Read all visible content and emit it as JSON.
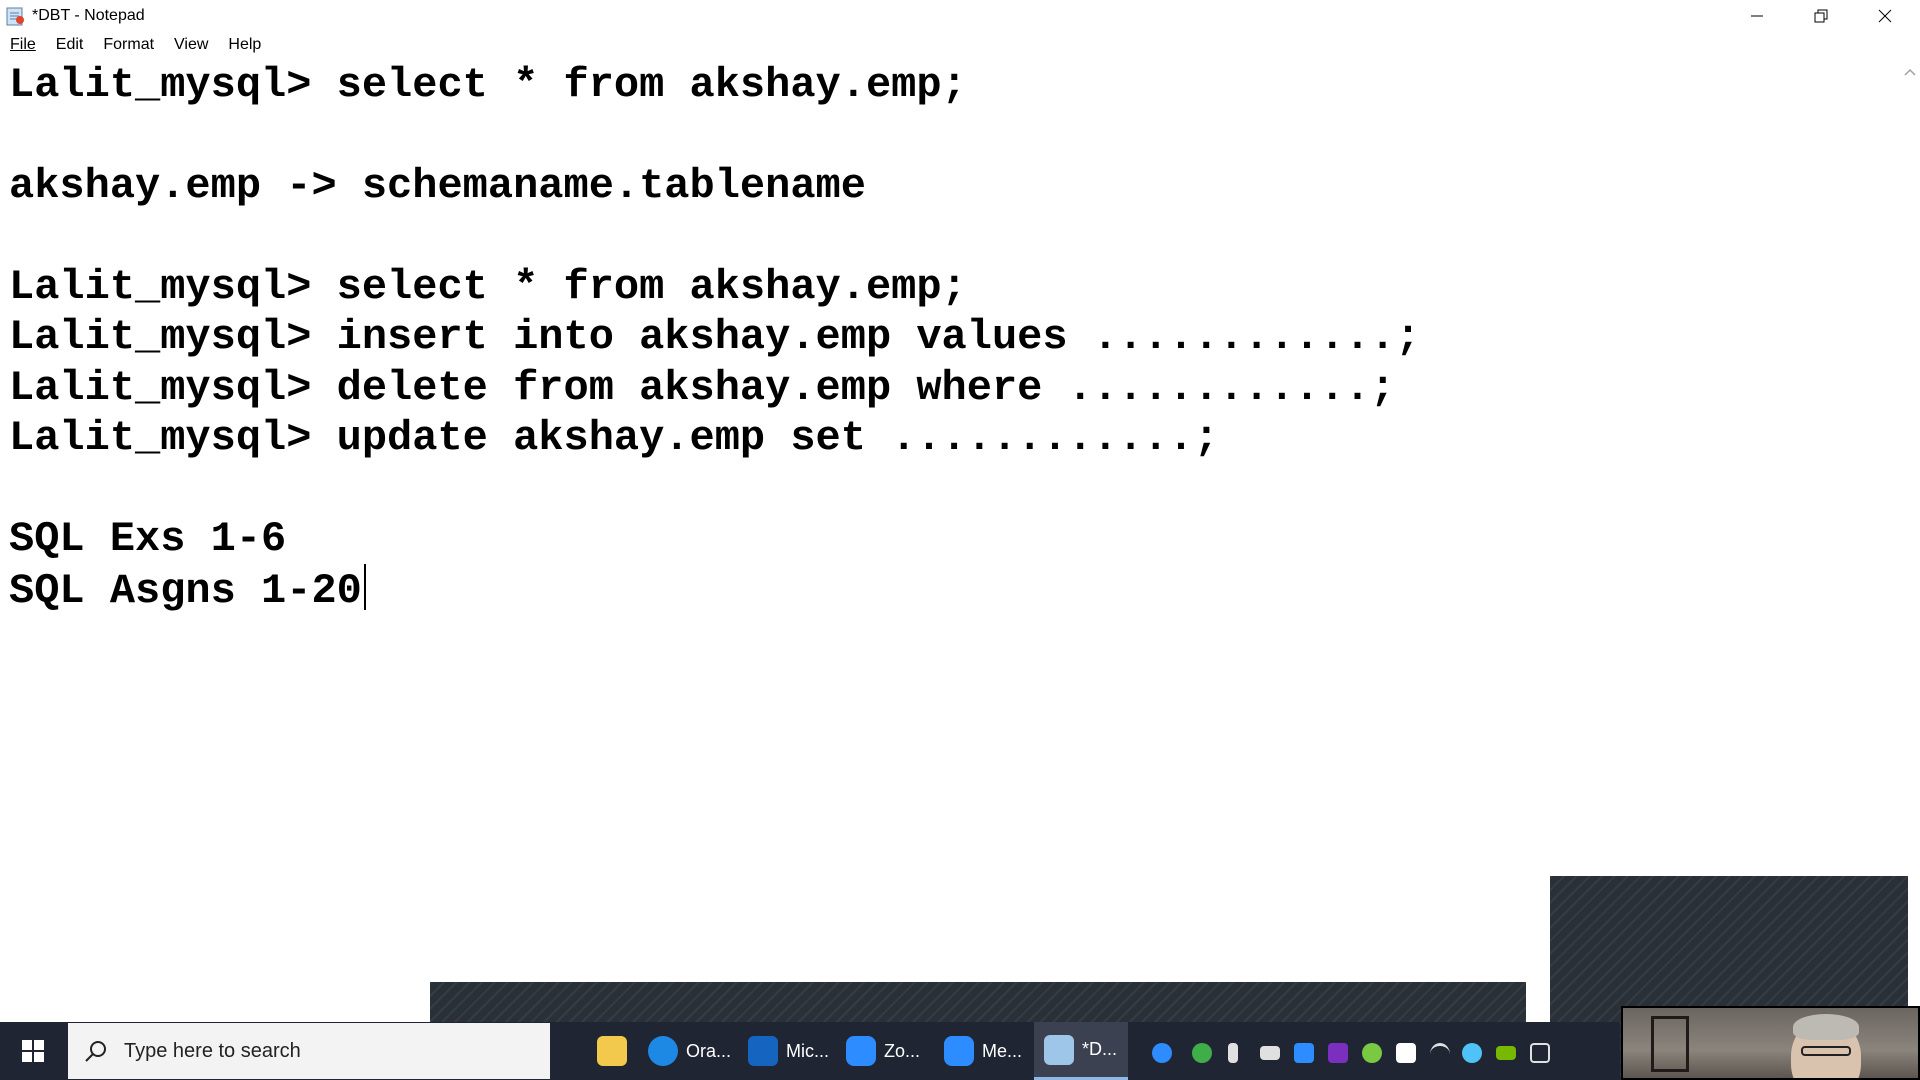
{
  "window": {
    "title": "*DBT - Notepad",
    "minimize_glyph": "—",
    "restore_glyph": "❐",
    "close_glyph": "✕"
  },
  "menu": {
    "items": [
      "File",
      "Edit",
      "Format",
      "View",
      "Help"
    ]
  },
  "editor": {
    "lines": [
      "Lalit_mysql> select * from akshay.emp;",
      "",
      "akshay.emp -> schemaname.tablename",
      "",
      "Lalit_mysql> select * from akshay.emp;",
      "Lalit_mysql> insert into akshay.emp values ............;",
      "Lalit_mysql> delete from akshay.emp where ............;",
      "Lalit_mysql> update akshay.emp set ............;",
      "",
      "SQL Exs 1-6",
      "SQL Asgns 1-20"
    ]
  },
  "taskbar": {
    "search_placeholder": "Type here to search",
    "apps": [
      {
        "label": "",
        "icon": "file-explorer-icon",
        "color": "#f2c94c"
      },
      {
        "label": "Ora...",
        "icon": "edge-icon",
        "color": "#1e88e5"
      },
      {
        "label": "Mic...",
        "icon": "whiteboard-icon",
        "color": "#1565c0"
      },
      {
        "label": "Zo...",
        "icon": "zoom-icon",
        "color": "#2d8cff"
      },
      {
        "label": "Me...",
        "icon": "zoom-meeting-icon",
        "color": "#2d8cff"
      },
      {
        "label": "*D...",
        "icon": "notepad-icon",
        "color": "#9ec6e8"
      }
    ],
    "tray": [
      {
        "icon": "help-icon",
        "color": "#2d8cff"
      },
      {
        "icon": "shield-check-icon",
        "color": "#3fae49"
      },
      {
        "icon": "microphone-icon",
        "color": "#e0e0e0"
      },
      {
        "icon": "keyboard-icon",
        "color": "#e0e0e0"
      },
      {
        "icon": "zoom-tray-icon",
        "color": "#2d8cff"
      },
      {
        "icon": "onenote-icon",
        "color": "#7b2fbe"
      },
      {
        "icon": "update-icon",
        "color": "#7ac943"
      },
      {
        "icon": "security-icon",
        "color": "#ffffff"
      },
      {
        "icon": "wifi-icon",
        "color": "#e0e0e0"
      },
      {
        "icon": "snowflake-icon",
        "color": "#4fc3f7"
      },
      {
        "icon": "nvidia-icon",
        "color": "#76b900"
      },
      {
        "icon": "display-icon",
        "color": "#e0e0e0"
      }
    ]
  }
}
